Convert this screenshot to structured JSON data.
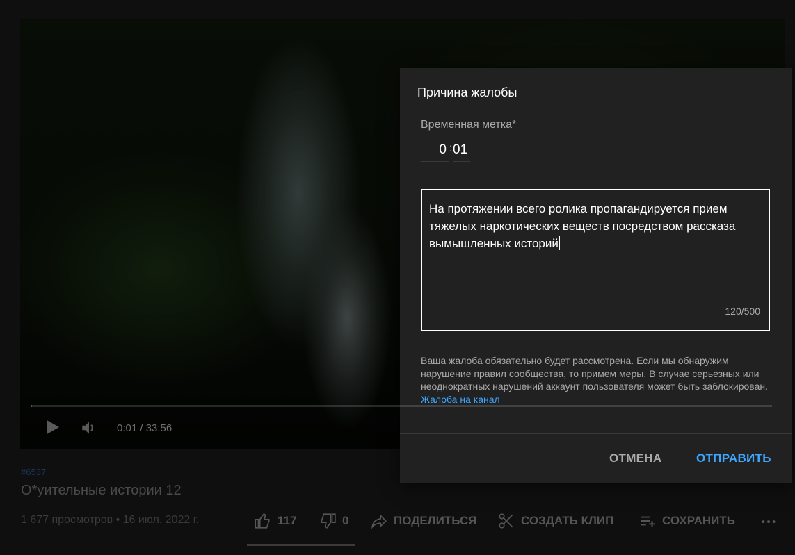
{
  "player": {
    "time": "0:01 / 33:56",
    "progress_fraction": 0.0005
  },
  "video": {
    "hashtag": "#6537",
    "title": "О*уительные истории 12",
    "meta": "1 677 просмотров • 16 июл. 2022 г."
  },
  "actions": {
    "like_count": "117",
    "dislike_count": "0",
    "share": "ПОДЕЛИТЬСЯ",
    "clip": "СОЗДАТЬ КЛИП",
    "save": "СОХРАНИТЬ"
  },
  "dialog": {
    "title": "Причина жалобы",
    "timestamp_label": "Временная метка*",
    "timestamp_minutes": "0",
    "timestamp_seconds": "01",
    "reason_text": "На протяжении всего ролика пропагандируется прием тяжелых наркотических веществ посредством рассказа вымышленных историй",
    "counter": "120/500",
    "notice": "Ваша жалоба обязательно будет рассмотрена. Если мы обнаружим нарушение правил сообщества, то примем меры. В случае серьезных или неоднократных нарушений аккаунт пользователя может быть заблокирован.",
    "channel_link": "Жалоба на канал",
    "cancel": "ОТМЕНА",
    "send": "ОТПРАВИТЬ"
  },
  "colors": {
    "accent": "#3ea6ff",
    "dialog_bg": "#212121",
    "page_bg": "#0f0f0f"
  }
}
